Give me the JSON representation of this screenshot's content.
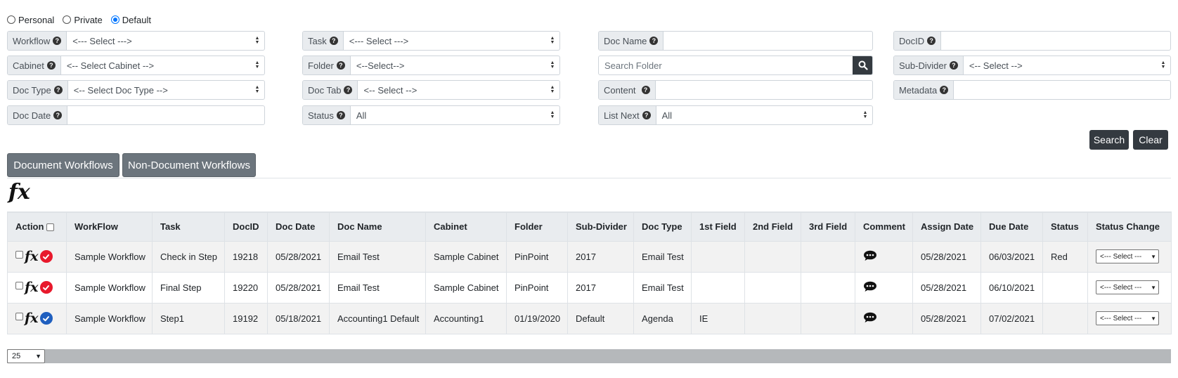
{
  "scope_radios": [
    {
      "label": "Personal",
      "checked": false
    },
    {
      "label": "Private",
      "checked": false
    },
    {
      "label": "Default",
      "checked": true
    }
  ],
  "filters": {
    "workflow": {
      "label": "Workflow",
      "value": "<--- Select --->"
    },
    "task": {
      "label": "Task",
      "value": "<--- Select --->"
    },
    "doc_name": {
      "label": "Doc Name",
      "value": ""
    },
    "docid": {
      "label": "DocID",
      "value": ""
    },
    "cabinet": {
      "label": "Cabinet",
      "value": "<-- Select Cabinet -->"
    },
    "folder": {
      "label": "Folder",
      "value": "<--Select-->"
    },
    "search_folder": {
      "placeholder": "Search Folder"
    },
    "sub_divider": {
      "label": "Sub-Divider",
      "value": "<-- Select -->"
    },
    "doc_type": {
      "label": "Doc Type",
      "value": "<-- Select Doc Type -->"
    },
    "doc_tab": {
      "label": "Doc Tab",
      "value": "<-- Select -->"
    },
    "content": {
      "label": "Content",
      "value": ""
    },
    "metadata": {
      "label": "Metadata",
      "value": ""
    },
    "doc_date": {
      "label": "Doc Date",
      "value": ""
    },
    "status": {
      "label": "Status",
      "value": "All"
    },
    "list_next": {
      "label": "List Next",
      "value": "All"
    }
  },
  "buttons": {
    "search": "Search",
    "clear": "Clear"
  },
  "tabs": {
    "document_workflows": "Document Workflows",
    "non_document_workflows": "Non-Document Workflows"
  },
  "fx_label": "fx",
  "table": {
    "columns": [
      "Action",
      "WorkFlow",
      "Task",
      "DocID",
      "Doc Date",
      "Doc Name",
      "Cabinet",
      "Folder",
      "Sub-Divider",
      "Doc Type",
      "1st Field",
      "2nd Field",
      "3rd Field",
      "Comment",
      "Assign Date",
      "Due Date",
      "Status",
      "Status Change"
    ],
    "rows": [
      {
        "workflow": "Sample Workflow",
        "task": "Check in Step",
        "docid": "19218",
        "doc_date": "05/28/2021",
        "doc_name": "Email Test",
        "cabinet": "Sample Cabinet",
        "folder": "PinPoint",
        "sub_divider": "2017",
        "doc_type": "Email Test",
        "field1": "",
        "field2": "",
        "field3": "",
        "assign_date": "05/28/2021",
        "due_date": "06/03/2021",
        "status": "Red",
        "status_icon_color": "#e8192c",
        "status_change": "<--- Select ---"
      },
      {
        "workflow": "Sample Workflow",
        "task": "Final Step",
        "docid": "19220",
        "doc_date": "05/28/2021",
        "doc_name": "Email Test",
        "cabinet": "Sample Cabinet",
        "folder": "PinPoint",
        "sub_divider": "2017",
        "doc_type": "Email Test",
        "field1": "",
        "field2": "",
        "field3": "",
        "assign_date": "05/28/2021",
        "due_date": "06/10/2021",
        "status": "",
        "status_icon_color": "#e8192c",
        "status_change": "<--- Select ---"
      },
      {
        "workflow": "Sample Workflow",
        "task": "Step1",
        "docid": "19192",
        "doc_date": "05/18/2021",
        "doc_name": "Accounting1 Default",
        "cabinet": "Accounting1",
        "folder": "01/19/2020",
        "sub_divider": "Default",
        "doc_type": "Agenda",
        "field1": "IE",
        "field2": "",
        "field3": "",
        "assign_date": "05/28/2021",
        "due_date": "07/02/2021",
        "status": "",
        "status_icon_color": "#1f5fbf",
        "status_change": "<--- Select ---"
      }
    ]
  },
  "page_size": "25",
  "colors": {
    "dark_button": "#343a40",
    "tab_button": "#6c757d",
    "status_red": "#e8192c",
    "status_blue": "#1f5fbf"
  }
}
